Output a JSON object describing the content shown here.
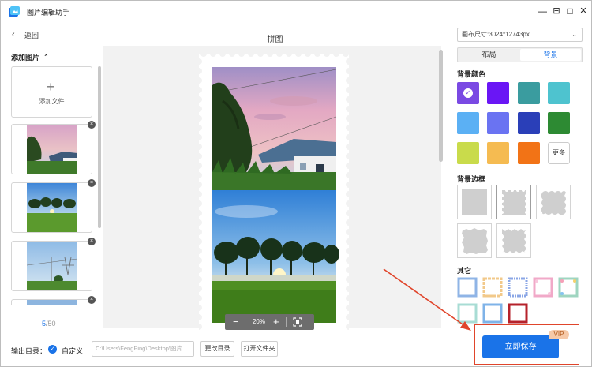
{
  "app": {
    "title": "图片编辑助手"
  },
  "window_controls": {
    "minimize": "—",
    "pin": "⊟",
    "maximize": "□",
    "close": "✕"
  },
  "nav": {
    "back_label": "返回"
  },
  "page": {
    "title": "拼图"
  },
  "left_panel": {
    "header": "添加图片",
    "add_file_label": "添加文件",
    "counter_current": "5",
    "counter_total": "/50"
  },
  "canvas": {
    "zoom": "20%"
  },
  "output": {
    "label": "输出目录：",
    "custom_label": "自定义",
    "path": "C:\\Users\\FengPing\\Desktop\\图片",
    "change_dir_label": "更改目录",
    "open_folder_label": "打开文件夹"
  },
  "right_panel": {
    "canvas_size": "画布尺寸:3024*12743px",
    "tabs": [
      {
        "label": "布局"
      },
      {
        "label": "背景"
      }
    ],
    "active_tab": "背景",
    "bg_color_label": "背景颜色",
    "colors": [
      "#7a49e3",
      "#6a16f5",
      "#3a9c9f",
      "#4ec3cf",
      "#5bb0f4",
      "#6a73f2",
      "#2a3fb8",
      "#2d8a33",
      "#c9db4b",
      "#f5bb51",
      "#f27316"
    ],
    "selected_color": "#7a49e3",
    "more_label": "更多",
    "bg_border_label": "背景边框",
    "other_label": "其它"
  },
  "save": {
    "label": "立即保存",
    "badge": "VIP"
  }
}
